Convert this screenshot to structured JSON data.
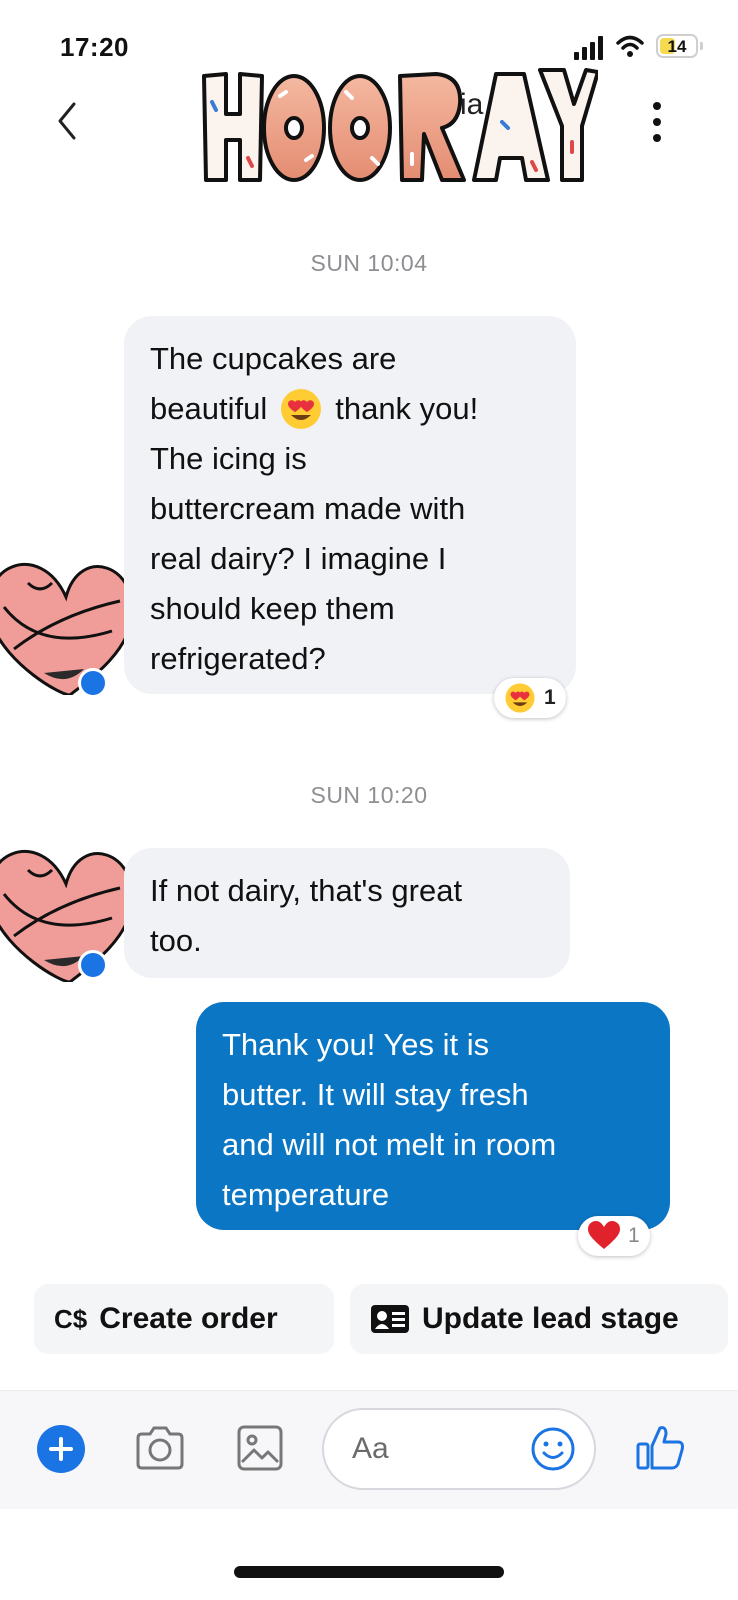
{
  "status_bar": {
    "time": "17:20",
    "battery": "14"
  },
  "header": {
    "logo_text": "HOORAY",
    "logo_subtext": "ia"
  },
  "conversation": [
    {
      "type": "timestamp",
      "text": "SUN 10:04"
    },
    {
      "type": "message",
      "direction": "incoming",
      "lines": [
        "The cupcakes are",
        "beautiful",
        "thank you!",
        "The icing is",
        "buttercream made with",
        "real dairy? I imagine I",
        "should keep them",
        "refrigerated?"
      ],
      "inline_emoji": "heart-eyes-emoji",
      "reaction": {
        "emoji": "heart-eyes-emoji",
        "count": "1"
      }
    },
    {
      "type": "timestamp",
      "text": "SUN 10:20"
    },
    {
      "type": "message",
      "direction": "incoming",
      "lines": [
        "If not dairy, that's great",
        "too."
      ]
    },
    {
      "type": "message",
      "direction": "outgoing",
      "lines": [
        "Thank you! Yes it is",
        "butter. It will stay fresh",
        "and will not melt in room",
        "temperature"
      ],
      "reaction": {
        "emoji": "red-heart-emoji",
        "count": "1"
      }
    }
  ],
  "quick_actions": [
    {
      "icon_text": "C$",
      "label": "Create order"
    },
    {
      "icon": "contact-card-icon",
      "label": "Update lead stage"
    }
  ],
  "composer": {
    "placeholder": "Aa",
    "icons": [
      "plus-icon",
      "camera-icon",
      "gallery-icon",
      "emoji-icon",
      "like-icon"
    ]
  },
  "colors": {
    "outgoing_bubble": "#0b76c4",
    "incoming_bubble": "#f1f2f6",
    "accent": "#1b74e4",
    "timestamp": "#8e8e93"
  }
}
